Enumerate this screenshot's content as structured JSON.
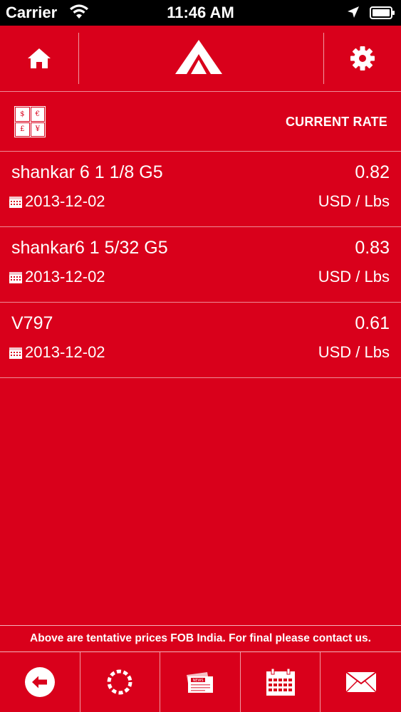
{
  "status_bar": {
    "carrier": "Carrier",
    "time": "11:46 AM"
  },
  "header": {
    "home_icon": "home-icon",
    "logo_icon": "tent-logo-icon",
    "settings_icon": "gear-icon"
  },
  "rate_bar": {
    "currency_symbols": [
      "$",
      "€",
      "£",
      "¥"
    ],
    "title": "CURRENT RATE"
  },
  "rates": [
    {
      "name": "shankar 6 1 1/8 G5",
      "price": "0.82",
      "date": "2013-12-02",
      "unit": "USD / Lbs"
    },
    {
      "name": "shankar6 1 5/32 G5",
      "price": "0.83",
      "date": "2013-12-02",
      "unit": "USD / Lbs"
    },
    {
      "name": "V797",
      "price": "0.61",
      "date": "2013-12-02",
      "unit": "USD / Lbs"
    }
  ],
  "notice": "Above are tentative prices FOB India. For final please contact us.",
  "tabbar": {
    "items": [
      "back-icon",
      "refresh-icon",
      "news-icon",
      "calendar-icon",
      "mail-icon"
    ],
    "news_badge": "NEWS"
  },
  "colors": {
    "brand_red": "#d9001b",
    "text": "#ffffff"
  }
}
